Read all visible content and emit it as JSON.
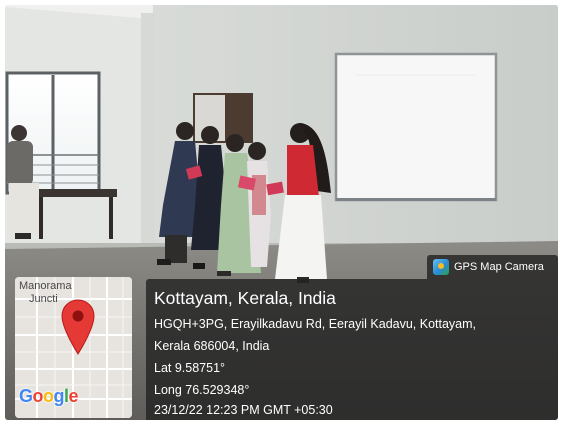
{
  "overlay": {
    "app_badge": {
      "label": "GPS Map Camera",
      "icon": "gps-map-camera-icon"
    },
    "location": {
      "title": "Kottayam, Kerala, India",
      "address_line1": "HGQH+3PG, Erayilkadavu Rd, Eerayil Kadavu, Kottayam,",
      "address_line2": "Kerala 686004, India",
      "latitude": "Lat 9.58751°",
      "longitude": "Long 76.529348°",
      "timestamp": "23/12/22 12:23 PM GMT +05:30"
    },
    "map": {
      "place_label_line1": "Manorama",
      "place_label_line2": "Juncti",
      "attribution": "Google",
      "pin_color": "#e53935",
      "google_colors": [
        "#4285F4",
        "#EA4335",
        "#FBBC05",
        "#4285F4",
        "#34A853",
        "#EA4335"
      ]
    }
  }
}
